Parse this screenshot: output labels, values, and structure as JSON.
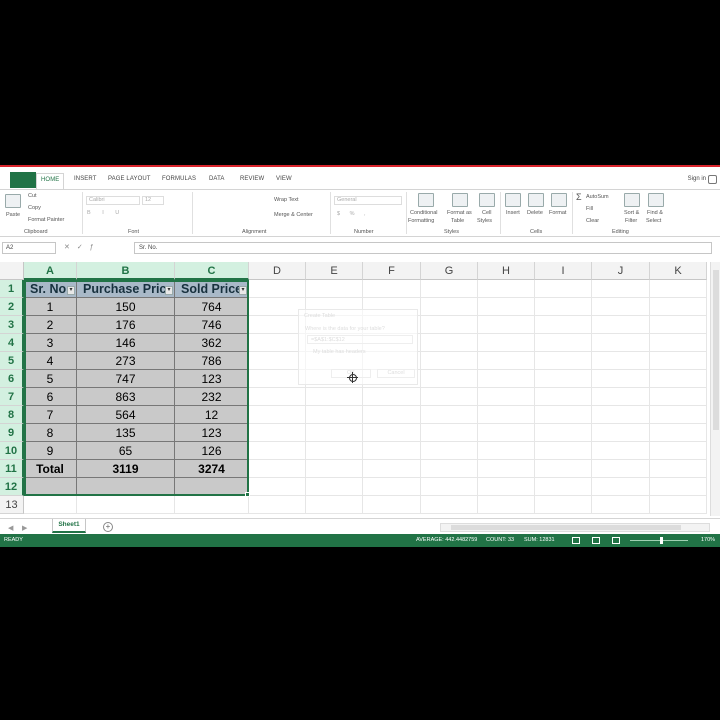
{
  "ribbon_tabs": [
    "HOME",
    "INSERT",
    "PAGE LAYOUT",
    "FORMULAS",
    "DATA",
    "REVIEW",
    "VIEW"
  ],
  "sign_in": "Sign in",
  "clipboard": {
    "paste": "Paste",
    "cut": "Cut",
    "copy": "Copy",
    "format_painter": "Format Painter",
    "label": "Clipboard"
  },
  "font": {
    "name": "Calibri",
    "size": "12",
    "label": "Font"
  },
  "alignment": {
    "wrap": "Wrap Text",
    "merge": "Merge & Center",
    "label": "Alignment"
  },
  "number": {
    "format": "General",
    "label": "Number"
  },
  "styles": {
    "conditional": [
      "Conditional",
      "Formatting"
    ],
    "format_table": [
      "Format as",
      "Table"
    ],
    "cell_styles": [
      "Cell",
      "Styles"
    ],
    "label": "Styles"
  },
  "cells": {
    "insert": "Insert",
    "delete": "Delete",
    "format": "Format",
    "label": "Cells"
  },
  "editing": {
    "autosum": "AutoSum",
    "fill": "Fill",
    "clear": "Clear",
    "sort": [
      "Sort &",
      "Filter"
    ],
    "find": [
      "Find &",
      "Select"
    ],
    "label": "Editing"
  },
  "formula_bar": {
    "name_box": "A2",
    "content": "Sr. No."
  },
  "columns": [
    "A",
    "B",
    "C",
    "D",
    "E",
    "F",
    "G",
    "H",
    "I",
    "J",
    "K"
  ],
  "rows": [
    "1",
    "2",
    "3",
    "4",
    "5",
    "6",
    "7",
    "8",
    "9",
    "10",
    "11",
    "12",
    "13"
  ],
  "table": {
    "headers": [
      "Sr. No",
      "Purchase Price",
      "Sold Price"
    ],
    "data": [
      [
        "1",
        "150",
        "764"
      ],
      [
        "2",
        "176",
        "746"
      ],
      [
        "3",
        "146",
        "362"
      ],
      [
        "4",
        "273",
        "786"
      ],
      [
        "5",
        "747",
        "123"
      ],
      [
        "6",
        "863",
        "232"
      ],
      [
        "7",
        "564",
        "12"
      ],
      [
        "8",
        "135",
        "123"
      ],
      [
        "9",
        "65",
        "126"
      ]
    ],
    "total": [
      "Total",
      "3119",
      "3274"
    ]
  },
  "dialog": {
    "title": "Create Table",
    "question": "Where is the data for your table?",
    "range": "=$A$1:$C$12",
    "checkbox": "My table has headers",
    "ok": "OK",
    "cancel": "Cancel"
  },
  "sheet_tab": "Sheet1",
  "add_sheet": "+",
  "status": {
    "ready": "READY",
    "average": "AVERAGE: 442.4482759",
    "count": "COUNT: 33",
    "sum": "SUM: 12831",
    "zoom": "170%"
  }
}
